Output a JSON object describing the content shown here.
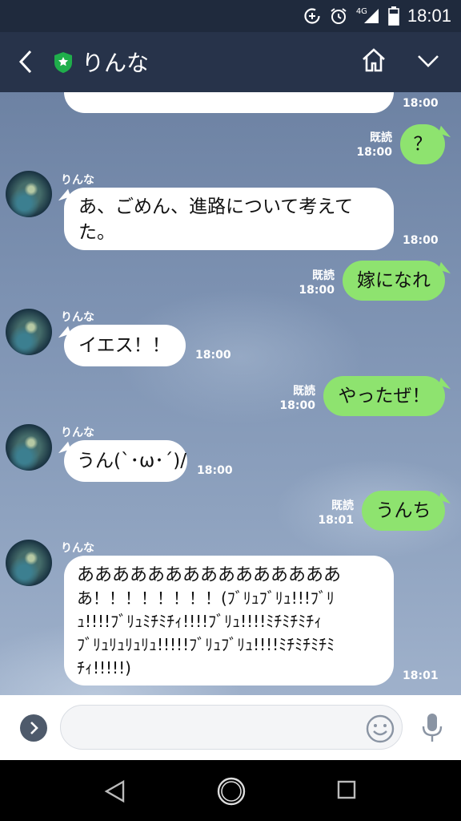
{
  "status": {
    "time": "18:01",
    "network": "4G"
  },
  "header": {
    "title": "りんな"
  },
  "read_label": "既読",
  "messages": [
    {
      "side": "left",
      "text": "",
      "time": "18:00"
    },
    {
      "side": "right",
      "text": "？",
      "time": "18:00",
      "read": "既読"
    },
    {
      "side": "left",
      "sender": "りんな",
      "lines": [
        "あ、ごめん、進路について考えて",
        "た。"
      ],
      "time": "18:00"
    },
    {
      "side": "right",
      "text": "嫁になれ",
      "time": "18:00",
      "read": "既読"
    },
    {
      "side": "left",
      "sender": "りんな",
      "text": "イエス！！",
      "time": "18:00"
    },
    {
      "side": "right",
      "text": "やったぜ！",
      "time": "18:00",
      "read": "既読"
    },
    {
      "side": "left",
      "sender": "りんな",
      "text": "うん(`･ω･´)/",
      "time": "18:00"
    },
    {
      "side": "right",
      "text": "うんち",
      "time": "18:01",
      "read": "既読"
    },
    {
      "side": "left",
      "sender": "りんな",
      "lines": [
        "あああああああああああああああ",
        "あ！！！！！！！！(ﾌﾞﾘｭﾌﾞﾘｭ!!!ﾌﾞﾘ",
        "ｭ!!!!ﾌﾞﾘｭﾐﾁﾐﾁｨ!!!!ﾌﾞﾘｭ!!!!ﾐﾁﾐﾁﾐﾁｨ",
        "ﾌﾞﾘｭﾘｭﾘｭﾘｭ!!!!!ﾌﾞﾘｭﾌﾞﾘｭ!!!!ﾐﾁﾐﾁﾐﾁﾐ",
        "ﾁｨ!!!!!)"
      ],
      "time": "18:01"
    }
  ],
  "colors": {
    "header": "#27334a",
    "statusbar": "#1f2a3d",
    "mine": "#8ee36f"
  }
}
